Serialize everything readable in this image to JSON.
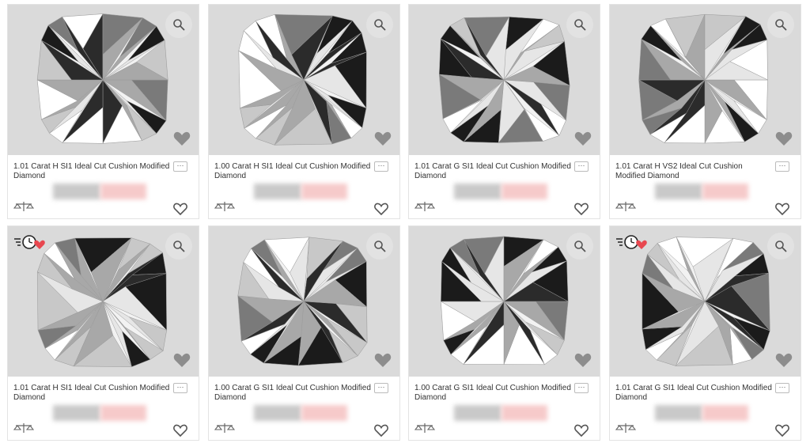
{
  "colors": {
    "photo_bg": "#dadada",
    "price_blur_gray": "#c9c9c9",
    "price_blur_pink": "#f6caca",
    "badge_heart": "#e8474f"
  },
  "cards": [
    {
      "title": "1.01 Carat H SI1 Ideal Cut Cushion Modified Diamond",
      "more": "···",
      "badge": false,
      "icons": [
        "search-icon",
        "heart-icon",
        "compare-icon",
        "favorite-icon"
      ]
    },
    {
      "title": "1.00 Carat H SI1 Ideal Cut Cushion Modified Diamond",
      "more": "···",
      "badge": false,
      "icons": [
        "search-icon",
        "heart-icon",
        "compare-icon",
        "favorite-icon"
      ]
    },
    {
      "title": "1.01 Carat G SI1 Ideal Cut Cushion Modified Diamond",
      "more": "···",
      "badge": false,
      "icons": [
        "search-icon",
        "heart-icon",
        "compare-icon",
        "favorite-icon"
      ]
    },
    {
      "title": "1.01 Carat H VS2 Ideal Cut Cushion Modified Diamond",
      "more": "···",
      "badge": false,
      "icons": [
        "search-icon",
        "heart-icon",
        "compare-icon",
        "favorite-icon"
      ]
    },
    {
      "title": "1.01 Carat H SI1 Ideal Cut Cushion Modified Diamond",
      "more": "···",
      "badge": true,
      "icons": [
        "fast-shipping-icon",
        "search-icon",
        "heart-icon",
        "compare-icon",
        "favorite-icon"
      ]
    },
    {
      "title": "1.00 Carat G SI1 Ideal Cut Cushion Modified Diamond",
      "more": "···",
      "badge": false,
      "icons": [
        "search-icon",
        "heart-icon",
        "compare-icon",
        "favorite-icon"
      ]
    },
    {
      "title": "1.00 Carat G SI1 Ideal Cut Cushion Modified Diamond",
      "more": "···",
      "badge": false,
      "icons": [
        "search-icon",
        "heart-icon",
        "compare-icon",
        "favorite-icon"
      ]
    },
    {
      "title": "1.01 Carat G SI1 Ideal Cut Cushion Modified Diamond",
      "more": "···",
      "badge": true,
      "icons": [
        "fast-shipping-icon",
        "search-icon",
        "heart-icon",
        "compare-icon",
        "favorite-icon"
      ]
    }
  ]
}
